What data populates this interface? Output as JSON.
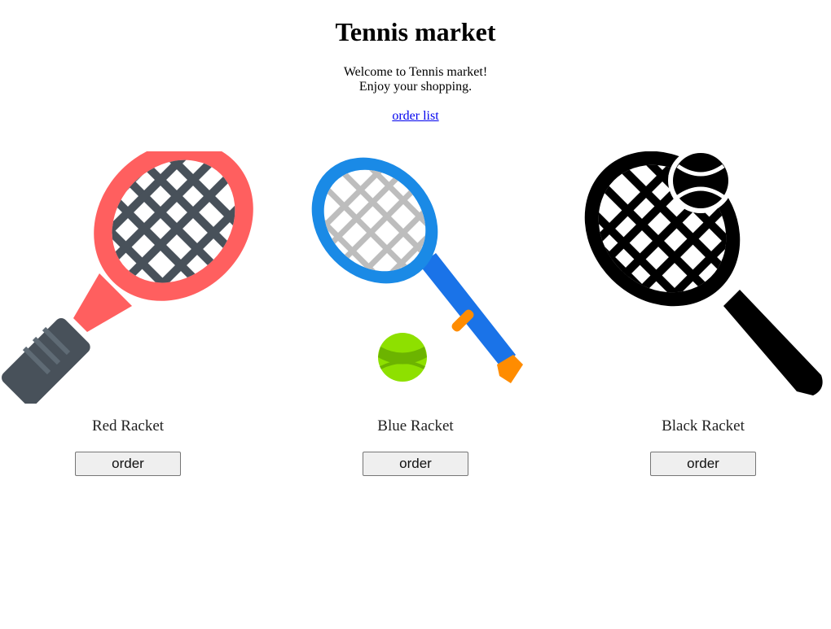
{
  "header": {
    "title": "Tennis market",
    "welcome_line1": "Welcome to Tennis market!",
    "welcome_line2": "Enjoy your shopping.",
    "order_list_link": "order list"
  },
  "products": [
    {
      "name": "Red Racket",
      "button": "order",
      "icon": "red-racket-icon"
    },
    {
      "name": "Blue Racket",
      "button": "order",
      "icon": "blue-racket-with-ball-icon"
    },
    {
      "name": "Black Racket",
      "button": "order",
      "icon": "black-racket-with-ball-icon"
    }
  ],
  "colors": {
    "red_frame": "#ff5f5f",
    "red_strings": "#48515a",
    "blue_frame": "#1a8ae6",
    "blue_handle": "#1a73e8",
    "orange_accent": "#ff8c00",
    "ball_green": "#8ee000",
    "link": "#0000ee"
  }
}
